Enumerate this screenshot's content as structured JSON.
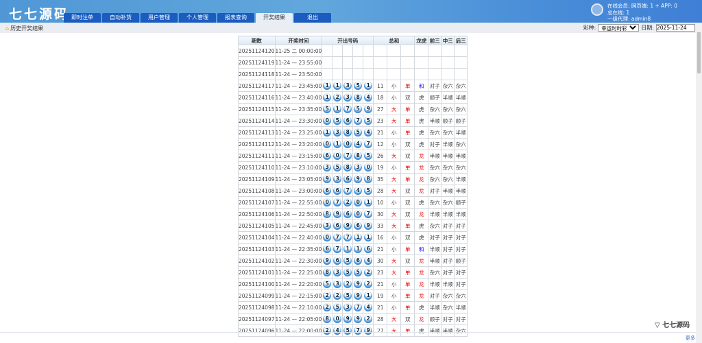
{
  "header": {
    "logo": "七七源码",
    "nav": [
      "即时注单",
      "自动补货",
      "用户管理",
      "个人管理",
      "报表查询",
      "开奖结果",
      "退出"
    ],
    "active": 5,
    "online": "在线会员: 网页端: 1 + APP: 0",
    "total": "总在线: 1",
    "agent": "一级代理: admin8"
  },
  "breadcrumb": "历史开奖结果",
  "filter": {
    "game_label": "彩种:",
    "game_value": "幸运时时彩",
    "date_label": "日期:",
    "date_value": "2025-11-24"
  },
  "table": {
    "headers": [
      "期数",
      "开奖时间",
      "开出号码",
      "总和",
      "龙虎",
      "前三",
      "中三",
      "后三"
    ],
    "rows": [
      [
        "20251124120",
        "11-25 二 00:00:00",
        [],
        "",
        "",
        "",
        "",
        "",
        "",
        ""
      ],
      [
        "20251124119",
        "11-24 — 23:55:00",
        [],
        "",
        "",
        "",
        "",
        "",
        "",
        ""
      ],
      [
        "20251124118",
        "11-24 — 23:50:00",
        [],
        "",
        "",
        "",
        "",
        "",
        "",
        ""
      ],
      [
        "20251124117",
        "11-24 — 23:45:00",
        [
          1,
          1,
          3,
          5,
          1
        ],
        "11",
        "小",
        "单",
        "和",
        "对子",
        "杂六",
        "杂六"
      ],
      [
        "20251124116",
        "11-24 — 23:40:00",
        [
          1,
          2,
          3,
          8,
          4
        ],
        "18",
        "小",
        "双",
        "虎",
        "顺子",
        "半顺",
        "半顺"
      ],
      [
        "20251124115",
        "11-24 — 23:35:00",
        [
          5,
          1,
          7,
          5,
          9
        ],
        "27",
        "大",
        "单",
        "虎",
        "杂六",
        "杂六",
        "杂六"
      ],
      [
        "20251124114",
        "11-24 — 23:30:00",
        [
          0,
          5,
          6,
          7,
          5
        ],
        "23",
        "大",
        "单",
        "虎",
        "半顺",
        "顺子",
        "顺子"
      ],
      [
        "20251124113",
        "11-24 — 23:25:00",
        [
          1,
          3,
          8,
          5,
          4
        ],
        "21",
        "小",
        "单",
        "虎",
        "杂六",
        "杂六",
        "半顺"
      ],
      [
        "20251124112",
        "11-24 — 23:20:00",
        [
          0,
          1,
          0,
          4,
          7
        ],
        "12",
        "小",
        "双",
        "虎",
        "对子",
        "半顺",
        "杂六"
      ],
      [
        "20251124111",
        "11-24 — 23:15:00",
        [
          6,
          0,
          7,
          8,
          5
        ],
        "26",
        "大",
        "双",
        "龙",
        "半顺",
        "半顺",
        "半顺"
      ],
      [
        "20251124110",
        "11-24 — 23:10:00",
        [
          3,
          5,
          8,
          3,
          0
        ],
        "19",
        "小",
        "单",
        "龙",
        "杂六",
        "杂六",
        "杂六"
      ],
      [
        "20251124109",
        "11-24 — 23:05:00",
        [
          9,
          3,
          6,
          9,
          8
        ],
        "35",
        "大",
        "单",
        "龙",
        "杂六",
        "杂六",
        "半顺"
      ],
      [
        "20251124108",
        "11-24 — 23:00:00",
        [
          6,
          6,
          7,
          4,
          5
        ],
        "28",
        "大",
        "双",
        "龙",
        "对子",
        "半顺",
        "半顺"
      ],
      [
        "20251124107",
        "11-24 — 22:55:00",
        [
          0,
          7,
          2,
          0,
          1
        ],
        "10",
        "小",
        "双",
        "虎",
        "杂六",
        "杂六",
        "顺子"
      ],
      [
        "20251124106",
        "11-24 — 22:50:00",
        [
          8,
          9,
          6,
          0,
          7
        ],
        "30",
        "大",
        "双",
        "龙",
        "半顺",
        "半顺",
        "半顺"
      ],
      [
        "20251124105",
        "11-24 — 22:45:00",
        [
          3,
          6,
          9,
          6,
          9
        ],
        "33",
        "大",
        "单",
        "虎",
        "杂六",
        "对子",
        "对子"
      ],
      [
        "20251124104",
        "11-24 — 22:40:00",
        [
          0,
          7,
          7,
          1,
          1
        ],
        "16",
        "小",
        "双",
        "虎",
        "对子",
        "对子",
        "对子"
      ],
      [
        "20251124103",
        "11-24 — 22:35:00",
        [
          6,
          7,
          1,
          1,
          6
        ],
        "21",
        "小",
        "单",
        "和",
        "半顺",
        "对子",
        "对子"
      ],
      [
        "20251124102",
        "11-24 — 22:30:00",
        [
          9,
          6,
          5,
          6,
          4
        ],
        "30",
        "大",
        "双",
        "龙",
        "半顺",
        "对子",
        "顺子"
      ],
      [
        "20251124101",
        "11-24 — 22:25:00",
        [
          8,
          3,
          5,
          5,
          2
        ],
        "23",
        "大",
        "单",
        "龙",
        "杂六",
        "对子",
        "对子"
      ],
      [
        "20251124100",
        "11-24 — 22:20:00",
        [
          5,
          3,
          2,
          9,
          2
        ],
        "21",
        "小",
        "单",
        "龙",
        "半顺",
        "半顺",
        "对子"
      ],
      [
        "20251124099",
        "11-24 — 22:15:00",
        [
          2,
          2,
          5,
          9,
          1
        ],
        "19",
        "小",
        "单",
        "龙",
        "对子",
        "杂六",
        "杂六"
      ],
      [
        "20251124098",
        "11-24 — 22:10:00",
        [
          2,
          5,
          3,
          7,
          4
        ],
        "21",
        "小",
        "单",
        "虎",
        "半顺",
        "杂六",
        "半顺"
      ],
      [
        "20251124097",
        "11-24 — 22:05:00",
        [
          8,
          0,
          9,
          9,
          2
        ],
        "28",
        "大",
        "双",
        "龙",
        "顺子",
        "对子",
        "对子"
      ],
      [
        "20251124096",
        "11-24 — 22:00:00",
        [
          2,
          4,
          5,
          7,
          9
        ],
        "27",
        "大",
        "单",
        "虎",
        "半顺",
        "半顺",
        "杂六"
      ]
    ]
  },
  "brand": "七七源码",
  "more": "更多"
}
